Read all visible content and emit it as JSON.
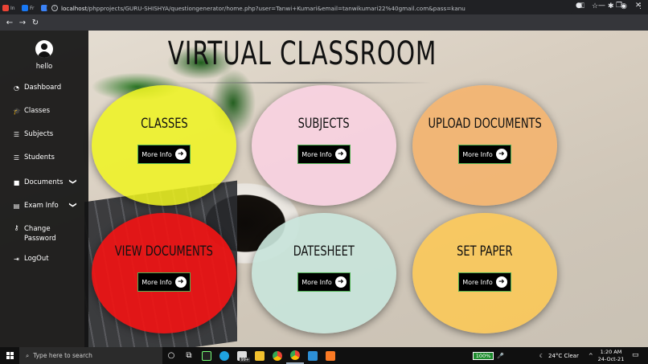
{
  "browser": {
    "tabs": [
      {
        "label": "In",
        "color": "#ea4335"
      },
      {
        "label": "Fr",
        "color": "#1877f2"
      },
      {
        "label": "D",
        "color": "#3b82f6"
      },
      {
        "label": "Pr",
        "color": "#8ab4f8"
      },
      {
        "label": "M",
        "color": "#fbbc05"
      },
      {
        "label": "Ta",
        "color": "#4285f4"
      },
      {
        "label": "Re",
        "color": "#34a853"
      },
      {
        "label": "Hi",
        "color": "#e0e0e0"
      },
      {
        "label": "Hi",
        "color": "#e0e0e0"
      },
      {
        "label": "Hi",
        "color": "#e0e0e0"
      },
      {
        "label": "Dr",
        "color": "#ff0000"
      },
      {
        "label": "Dr",
        "color": "#0f9d58"
      },
      {
        "label": "Sc",
        "color": "#1a73e8"
      },
      {
        "label": "Eh",
        "color": "#f0652f"
      },
      {
        "label": "Ne",
        "color": "#e8eaed"
      },
      {
        "label": "to",
        "color": "#ffb300"
      },
      {
        "label": "gs",
        "color": "#4285f4"
      },
      {
        "label": "Eh",
        "color": "#f0652f"
      },
      {
        "label": "Br",
        "color": "#9c27b0"
      },
      {
        "label": "Tl",
        "color": "#03a9f4"
      },
      {
        "label": "Gi",
        "color": "#f0652f"
      },
      {
        "label": "fe",
        "color": "#4285f4"
      },
      {
        "label": "lo",
        "color": "#f0652f"
      },
      {
        "label": "Cl",
        "color": "#ff0000"
      }
    ],
    "active_tab_color": "#f0652f",
    "new_tab": "+",
    "url_host": "localhost",
    "url_path": "/phpprojects/GURU-SHISHYA/questiongenerator/home.php?user=Tanwi+Kumari&email=tanwikumari22%40gmail.com&pass=kanu"
  },
  "sidebar": {
    "greeting": "hello",
    "items": [
      {
        "label": "Dashboard",
        "icon": "tachometer-icon",
        "glyph": "◔"
      },
      {
        "label": "Classes",
        "icon": "graduation-cap-icon",
        "glyph": "🎓"
      },
      {
        "label": "Subjects",
        "icon": "list-icon",
        "glyph": "☰"
      },
      {
        "label": "Students",
        "icon": "list-icon",
        "glyph": "☰"
      },
      {
        "label": "Documents",
        "icon": "folder-icon",
        "glyph": "■"
      },
      {
        "label": "Exam Info",
        "icon": "id-card-icon",
        "glyph": "▤"
      },
      {
        "label": "Change",
        "label2": "Password",
        "icon": "key-icon",
        "glyph": "⚷"
      },
      {
        "label": "LogOut",
        "icon": "sign-out-icon",
        "glyph": "⇥"
      }
    ],
    "chevron": "❯"
  },
  "main": {
    "title": "VIRTUAL CLASSROOM",
    "more_label": "More Info",
    "cards": [
      {
        "label": "CLASSES",
        "color": "rgba(240,245,30,0.85)"
      },
      {
        "label": "SUBJECTS",
        "color": "rgba(248,210,225,0.9)"
      },
      {
        "label": "UPLOAD DOCUMENTS",
        "color": "rgba(244,180,110,0.9)"
      },
      {
        "label": "VIEW DOCUMENTS",
        "color": "rgba(240,20,20,0.92)"
      },
      {
        "label": "DATESHEET",
        "color": "rgba(200,228,218,0.92)"
      },
      {
        "label": "SET PAPER",
        "color": "rgba(250,200,90,0.92)"
      }
    ]
  },
  "taskbar": {
    "search_placeholder": "Type here to search",
    "battery": "100%",
    "weather": "24°C  Clear",
    "time": "1:20 AM",
    "date": "24-Oct-21",
    "notification_count": "99+"
  }
}
